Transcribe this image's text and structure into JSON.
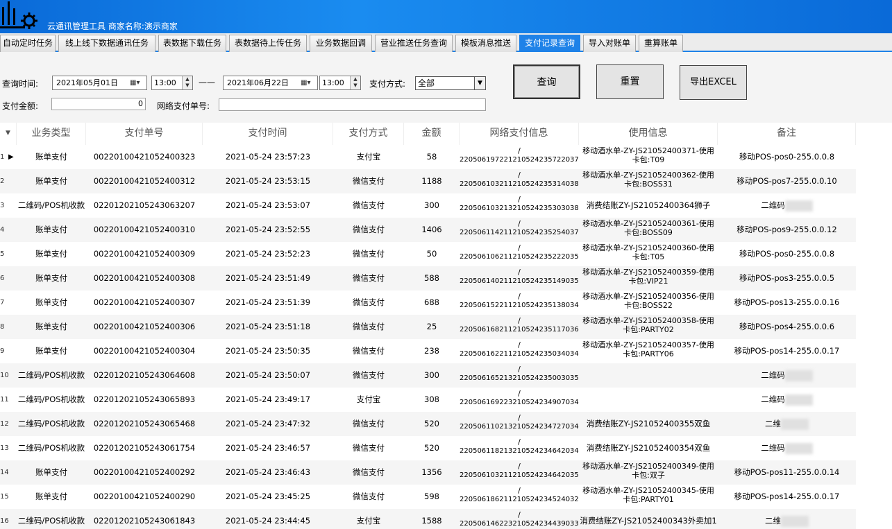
{
  "app": {
    "title": "云通讯管理工具  商家名称:演示商家"
  },
  "tabs": [
    {
      "label": "自动定时任务",
      "active": false
    },
    {
      "label": "线上线下数据通讯任务",
      "active": false
    },
    {
      "label": "表数据下载任务",
      "active": false
    },
    {
      "label": "表数据待上传任务",
      "active": false
    },
    {
      "label": "业务数据回调",
      "active": false
    },
    {
      "label": "营业推送任务查询",
      "active": false
    },
    {
      "label": "模板消息推送",
      "active": false
    },
    {
      "label": "支付记录查询",
      "active": true
    },
    {
      "label": "导入对账单",
      "active": false
    },
    {
      "label": "重算账单",
      "active": false
    }
  ],
  "filters": {
    "query_time_label": "查询时间:",
    "start_date": "2021年05月01日",
    "start_time": "13:00",
    "range_sep": "——",
    "end_date": "2021年06月22日",
    "end_time": "13:00",
    "pay_method_label": "支付方式:",
    "pay_method_value": "全部",
    "amount_label": "支付金额:",
    "amount_value": "0",
    "net_pay_no_label": "网络支付单号:",
    "net_pay_no_value": ""
  },
  "buttons": {
    "query": "查询",
    "reset": "重置",
    "export": "导出EXCEL"
  },
  "grid": {
    "columns": [
      "业务类型",
      "支付单号",
      "支付时间",
      "支付方式",
      "金额",
      "网络支付信息",
      "使用信息",
      "备注"
    ],
    "rows": [
      {
        "num": "1",
        "type": "账单支付",
        "pay_no": "00220100421052400323",
        "time": "2021-05-24 23:57:23",
        "method": "支付宝",
        "amount": "58",
        "net_info": [
          "/",
          "22050619722121052423572203790"
        ],
        "usage": [
          "移动酒水单-ZY-JS21052400371-使用",
          "卡包:T09"
        ],
        "note": "移动POS-pos0-255.0.0.8"
      },
      {
        "num": "2",
        "type": "账单支付",
        "pay_no": "00220100421052400312",
        "time": "2021-05-24 23:53:15",
        "method": "微信支付",
        "amount": "1188",
        "net_info": [
          "/",
          "22050610321121052423531403860"
        ],
        "usage": [
          "移动酒水单-ZY-JS21052400362-使用",
          "卡包:BOSS31"
        ],
        "note": "移动POS-pos7-255.0.0.10"
      },
      {
        "num": "3",
        "type": "二维码/POS机收款",
        "pay_no": "02201202105243063207",
        "time": "2021-05-24 23:53:07",
        "method": "微信支付",
        "amount": "300",
        "net_info": [
          "/",
          "22050610321321052423530303850"
        ],
        "usage": [
          "消费结账ZY-JS21052400364狮子"
        ],
        "note": "二维码",
        "note_blur": true
      },
      {
        "num": "4",
        "type": "账单支付",
        "pay_no": "00220100421052400310",
        "time": "2021-05-24 23:52:55",
        "method": "微信支付",
        "amount": "1406",
        "net_info": [
          "/",
          "22050611421121052423525403750"
        ],
        "usage": [
          "移动酒水单-ZY-JS21052400361-使用",
          "卡包:BOSS09"
        ],
        "note": "移动POS-pos9-255.0.0.12"
      },
      {
        "num": "5",
        "type": "账单支付",
        "pay_no": "00220100421052400309",
        "time": "2021-05-24 23:52:23",
        "method": "微信支付",
        "amount": "50",
        "net_info": [
          "/",
          "22050610621121052423522203590"
        ],
        "usage": [
          "移动酒水单-ZY-JS21052400360-使用",
          "卡包:T05"
        ],
        "note": "移动POS-pos0-255.0.0.8"
      },
      {
        "num": "6",
        "type": "账单支付",
        "pay_no": "00220100421052400308",
        "time": "2021-05-24 23:51:49",
        "method": "微信支付",
        "amount": "588",
        "net_info": [
          "/",
          "22050614021121052423514903540"
        ],
        "usage": [
          "移动酒水单-ZY-JS21052400359-使用",
          "卡包:VIP21"
        ],
        "note": "移动POS-pos3-255.0.0.5"
      },
      {
        "num": "7",
        "type": "账单支付",
        "pay_no": "00220100421052400307",
        "time": "2021-05-24 23:51:39",
        "method": "微信支付",
        "amount": "688",
        "net_info": [
          "/",
          "22050615221121052423513803460"
        ],
        "usage": [
          "移动酒水单-ZY-JS21052400356-使用",
          "卡包:BOSS22"
        ],
        "note": "移动POS-pos13-255.0.0.16"
      },
      {
        "num": "8",
        "type": "账单支付",
        "pay_no": "00220100421052400306",
        "time": "2021-05-24 23:51:18",
        "method": "微信支付",
        "amount": "25",
        "net_info": [
          "/",
          "22050616821121052423511703620"
        ],
        "usage": [
          "移动酒水单-ZY-JS21052400358-使用",
          "卡包:PARTY02"
        ],
        "note": "移动POS-pos4-255.0.0.6"
      },
      {
        "num": "9",
        "type": "账单支付",
        "pay_no": "00220100421052400304",
        "time": "2021-05-24 23:50:35",
        "method": "微信支付",
        "amount": "238",
        "net_info": [
          "/",
          "22050616221121052423503403480"
        ],
        "usage": [
          "移动酒水单-ZY-JS21052400357-使用",
          "卡包:PARTY06"
        ],
        "note": "移动POS-pos14-255.0.0.17"
      },
      {
        "num": "10",
        "type": "二维码/POS机收款",
        "pay_no": "02201202105243064608",
        "time": "2021-05-24 23:50:07",
        "method": "微信支付",
        "amount": "300",
        "net_info": [
          "/",
          "22050616521321052423500303500"
        ],
        "usage": [],
        "note": "二维码",
        "note_blur": true
      },
      {
        "num": "11",
        "type": "二维码/POS机收款",
        "pay_no": "02201202105243065893",
        "time": "2021-05-24 23:49:17",
        "method": "支付宝",
        "amount": "308",
        "net_info": [
          "/",
          "22050616922321052423490703420"
        ],
        "usage": [],
        "note": "二维码",
        "note_blur": true
      },
      {
        "num": "12",
        "type": "二维码/POS机收款",
        "pay_no": "02201202105243065468",
        "time": "2021-05-24 23:47:32",
        "method": "微信支付",
        "amount": "520",
        "net_info": [
          "/",
          "22050611021321052423472703410"
        ],
        "usage": [
          "消费结账ZY-JS21052400355双鱼"
        ],
        "note": "二维",
        "note_blur": true
      },
      {
        "num": "13",
        "type": "二维码/POS机收款",
        "pay_no": "02201202105243061754",
        "time": "2021-05-24 23:46:57",
        "method": "微信支付",
        "amount": "520",
        "net_info": [
          "/",
          "22050611821321052423464203400"
        ],
        "usage": [
          "消费结账ZY-JS21052400354双鱼"
        ],
        "note": "二维码",
        "note_blur": true
      },
      {
        "num": "14",
        "type": "账单支付",
        "pay_no": "00220100421052400292",
        "time": "2021-05-24 23:46:43",
        "method": "微信支付",
        "amount": "1356",
        "net_info": [
          "/",
          "22050610321121052423464203510"
        ],
        "usage": [
          "移动酒水单-ZY-JS21052400349-使用",
          "卡包:双子"
        ],
        "note": "移动POS-pos11-255.0.0.14"
      },
      {
        "num": "15",
        "type": "账单支付",
        "pay_no": "00220100421052400290",
        "time": "2021-05-24 23:45:25",
        "method": "微信支付",
        "amount": "598",
        "net_info": [
          "/",
          "22050618621121052423452403230"
        ],
        "usage": [
          "移动酒水单-ZY-JS21052400345-使用",
          "卡包:PARTY01"
        ],
        "note": "移动POS-pos14-255.0.0.17"
      },
      {
        "num": "16",
        "type": "二维码/POS机收款",
        "pay_no": "02201202105243061843",
        "time": "2021-05-24 23:44:45",
        "method": "支付宝",
        "amount": "1588",
        "net_info": [
          "/",
          "22050614622321052423443903300"
        ],
        "usage": [
          "消费结账ZY-JS21052400343外卖加1"
        ],
        "note": "二维",
        "note_blur": true
      }
    ]
  }
}
